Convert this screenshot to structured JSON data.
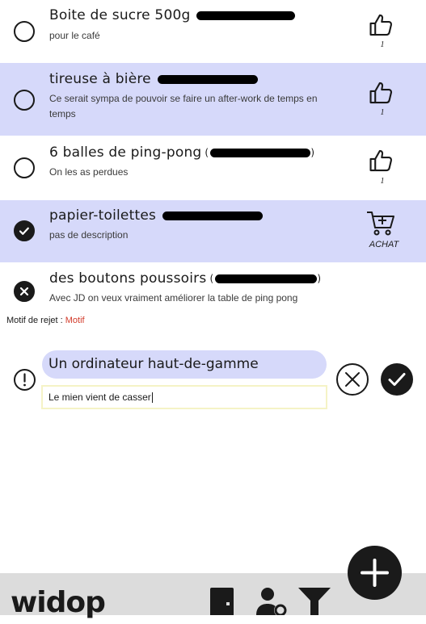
{
  "items": [
    {
      "title": "Boite de sucre 500g",
      "description": "pour le café",
      "count": "1",
      "action": "like"
    },
    {
      "title": "tireuse à bière",
      "description_line1": "Ce serait sympa de pouvoir se faire un after-work de temps en",
      "description_line2": "temps",
      "count": "1",
      "action": "like"
    },
    {
      "title": "6 balles de ping-pong",
      "description": "On les as perdues",
      "count": "1",
      "action": "like"
    },
    {
      "title": "papier-toilettes",
      "description": "pas de description",
      "action_label": "ACHAT",
      "action": "buy"
    },
    {
      "title": "des boutons poussoirs",
      "description": "Avec JD on veux vraiment améliorer la table de ping pong",
      "action": "rejected"
    }
  ],
  "rejection": {
    "label": "Motif de rejet :",
    "value": "Motif"
  },
  "new_item": {
    "title_value": "Un ordinateur haut-de-gamme",
    "description_value": "Le mien vient de casser"
  },
  "footer": {
    "logo": "widop"
  },
  "colors": {
    "highlight": "#d6d9fa",
    "reject": "#d23b2a",
    "dark": "#1a1a1a",
    "footer": "#dcdcdc"
  },
  "icons": {
    "like": "thumbs-up-icon",
    "buy": "cart-plus-icon",
    "add": "plus-icon",
    "door": "door-icon",
    "user": "user-settings-icon",
    "filter": "filter-icon"
  }
}
